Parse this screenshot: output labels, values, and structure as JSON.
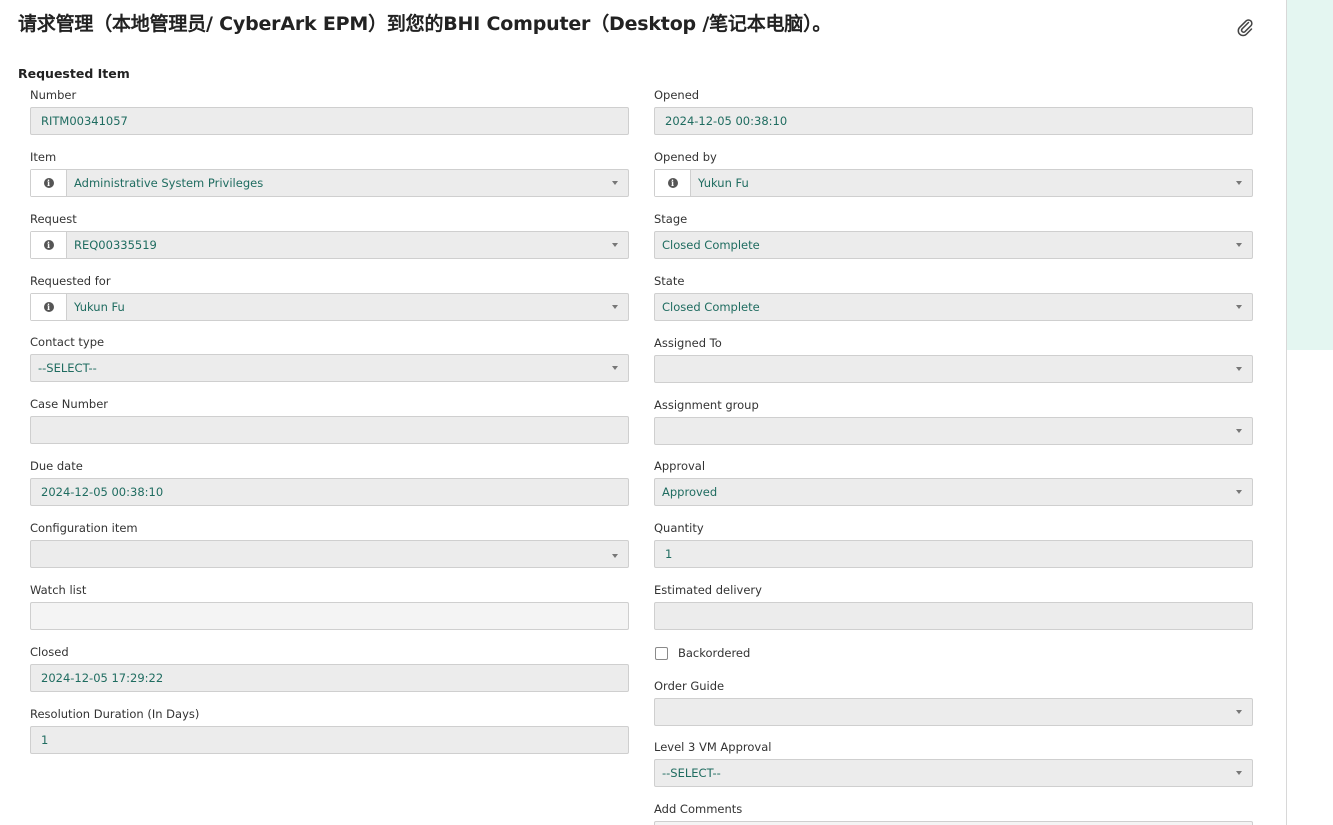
{
  "header": {
    "title": "请求管理（本地管理员/ CyberArk EPM）到您的BHI Computer（Desktop /笔记本电脑）。",
    "attachment_icon": "paperclip-icon"
  },
  "section": {
    "title": "Requested Item"
  },
  "left": {
    "number": {
      "label": "Number",
      "value": "RITM00341057"
    },
    "item": {
      "label": "Item",
      "value": "Administrative System Privileges"
    },
    "request": {
      "label": "Request",
      "value": "REQ00335519"
    },
    "requested_for": {
      "label": "Requested for",
      "value": "Yukun Fu"
    },
    "contact_type": {
      "label": "Contact type",
      "value": "--SELECT--"
    },
    "case_number": {
      "label": "Case Number",
      "value": ""
    },
    "due_date": {
      "label": "Due date",
      "value": "2024-12-05 00:38:10"
    },
    "configuration_item": {
      "label": "Configuration item",
      "value": ""
    },
    "watch_list": {
      "label": "Watch list",
      "value": ""
    },
    "closed": {
      "label": "Closed",
      "value": "2024-12-05 17:29:22"
    },
    "resolution_duration": {
      "label": "Resolution Duration (In Days)",
      "value": "1"
    }
  },
  "right": {
    "opened": {
      "label": "Opened",
      "value": "2024-12-05 00:38:10"
    },
    "opened_by": {
      "label": "Opened by",
      "value": "Yukun Fu"
    },
    "stage": {
      "label": "Stage",
      "value": "Closed Complete"
    },
    "state": {
      "label": "State",
      "value": "Closed Complete"
    },
    "assigned_to": {
      "label": "Assigned To",
      "value": ""
    },
    "assignment_group": {
      "label": "Assignment group",
      "value": ""
    },
    "approval": {
      "label": "Approval",
      "value": "Approved"
    },
    "quantity": {
      "label": "Quantity",
      "value": "1"
    },
    "estimated_delivery": {
      "label": "Estimated delivery",
      "value": ""
    },
    "backordered": {
      "label": "Backordered",
      "checked": false
    },
    "order_guide": {
      "label": "Order Guide",
      "value": ""
    },
    "level3_vm_approval": {
      "label": "Level 3 VM Approval",
      "value": "--SELECT--"
    },
    "add_comments": {
      "label": "Add Comments"
    }
  },
  "colors": {
    "value_text": "#1f6c60",
    "field_bg": "#ececec",
    "side_panel": "#e4f6f1"
  }
}
